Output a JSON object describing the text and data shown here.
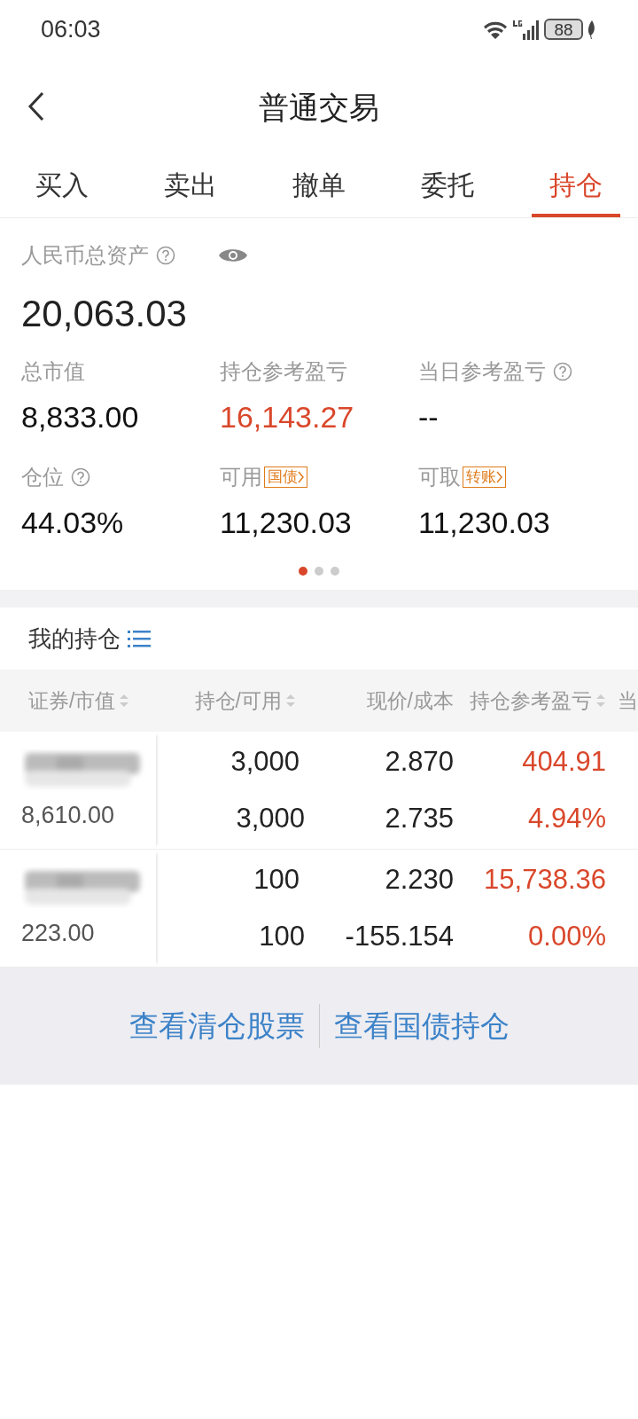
{
  "status_bar": {
    "time": "06:03",
    "battery": "88"
  },
  "header": {
    "title": "普通交易"
  },
  "tabs": [
    {
      "label": "买入",
      "selected": false
    },
    {
      "label": "卖出",
      "selected": false
    },
    {
      "label": "撤单",
      "selected": false
    },
    {
      "label": "委托",
      "selected": false
    },
    {
      "label": "持仓",
      "selected": true
    }
  ],
  "assets": {
    "label": "人民币总资产",
    "value": "20,063.03"
  },
  "stats": [
    {
      "label": "总市值",
      "value": "8,833.00",
      "help": false,
      "rising": false
    },
    {
      "label": "持仓参考盈亏",
      "value": "16,143.27",
      "help": false,
      "rising": true
    },
    {
      "label": "当日参考盈亏",
      "value": "--",
      "help": true,
      "rising": false
    },
    {
      "label": "仓位",
      "value": "44.03%",
      "help": true,
      "rising": false
    },
    {
      "label": "可用",
      "value": "11,230.03",
      "help": false,
      "rising": false,
      "tag": "国债"
    },
    {
      "label": "可取",
      "value": "11,230.03",
      "help": false,
      "rising": false,
      "tag": "转账"
    }
  ],
  "pages": [
    {
      "selected": true
    },
    {
      "selected": false
    },
    {
      "selected": false
    }
  ],
  "holdings": {
    "title": "我的持仓",
    "columns": [
      {
        "label": "证券/市值",
        "sortable": true
      },
      {
        "label": "持仓/可用",
        "sortable": true
      },
      {
        "label": "现价/成本",
        "sortable": false
      },
      {
        "label": "持仓参考盈亏",
        "sortable": true
      },
      {
        "label": "当",
        "sortable": false
      }
    ],
    "rows": [
      {
        "market_value": "8,610.00",
        "quantity": "3,000",
        "available": "3,000",
        "price": "2.870",
        "cost": "2.735",
        "pnl": "404.91",
        "pnl_pct": "4.94%"
      },
      {
        "market_value": "223.00",
        "quantity": "100",
        "available": "100",
        "price": "2.230",
        "cost": "-155.154",
        "pnl": "15,738.36",
        "pnl_pct": "0.00%"
      }
    ]
  },
  "links": [
    "查看清仓股票",
    "查看国债持仓"
  ]
}
